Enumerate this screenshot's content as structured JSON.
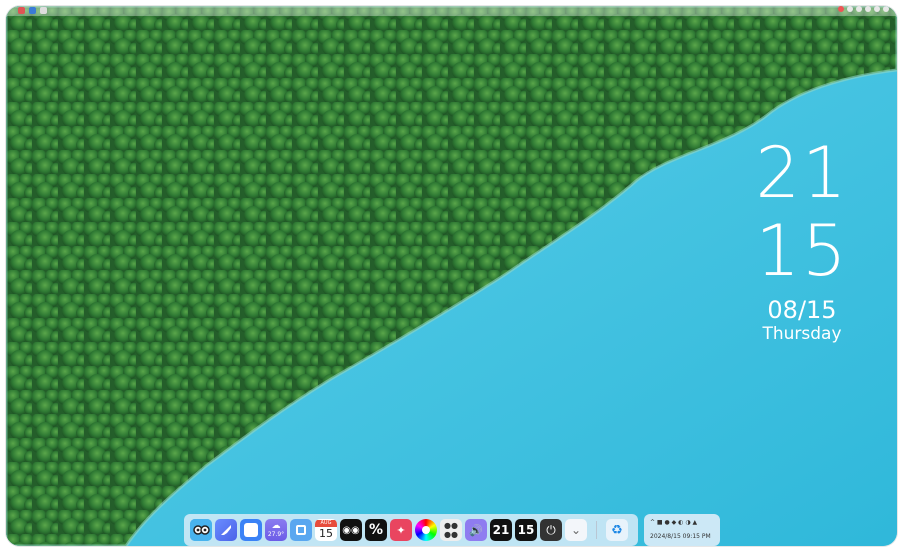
{
  "widget_clock": {
    "hour": "21",
    "minute": "15",
    "date": "08/15",
    "weekday": "Thursday"
  },
  "dock": {
    "apps": [
      {
        "name": "finder-app",
        "icon": "face-glasses-icon"
      },
      {
        "name": "launchpad-app",
        "icon": "rocket-icon"
      },
      {
        "name": "blank-window-app",
        "icon": "window-icon"
      },
      {
        "name": "weather-app",
        "icon": "cloud-icon",
        "text": "27.9°"
      },
      {
        "name": "screenshot-app",
        "icon": "square-dot-icon"
      },
      {
        "name": "calendar-app",
        "icon": "calendar-icon",
        "month": "AUG",
        "day": "15"
      },
      {
        "name": "eyes-app",
        "icon": "eyes-icon"
      },
      {
        "name": "percent-app",
        "icon": "percent-icon",
        "text": "%"
      },
      {
        "name": "cleaner-app",
        "icon": "sparkle-icon"
      },
      {
        "name": "color-app",
        "icon": "color-wheel-icon"
      },
      {
        "name": "switch-app",
        "icon": "dots-icon"
      },
      {
        "name": "volume-app",
        "icon": "speaker-icon"
      },
      {
        "name": "clock-hour-app",
        "icon": "digit-icon",
        "text": "21"
      },
      {
        "name": "clock-minute-app",
        "icon": "digit-icon",
        "text": "15"
      },
      {
        "name": "power-app",
        "icon": "power-icon",
        "text": "⏻"
      },
      {
        "name": "expand-app",
        "icon": "chevron-down-icon",
        "text": "⌄"
      }
    ],
    "recycle_icon": "recycle-icon"
  },
  "tray": {
    "icons": "^ ■ ● ◆ ◐ ◑ ▲",
    "datetime": "2024/8/15 09:15 PM"
  },
  "colors": {
    "water": "#39c1df",
    "forest": "#2a6b2e",
    "dock_bg": "#e6f0fa"
  }
}
